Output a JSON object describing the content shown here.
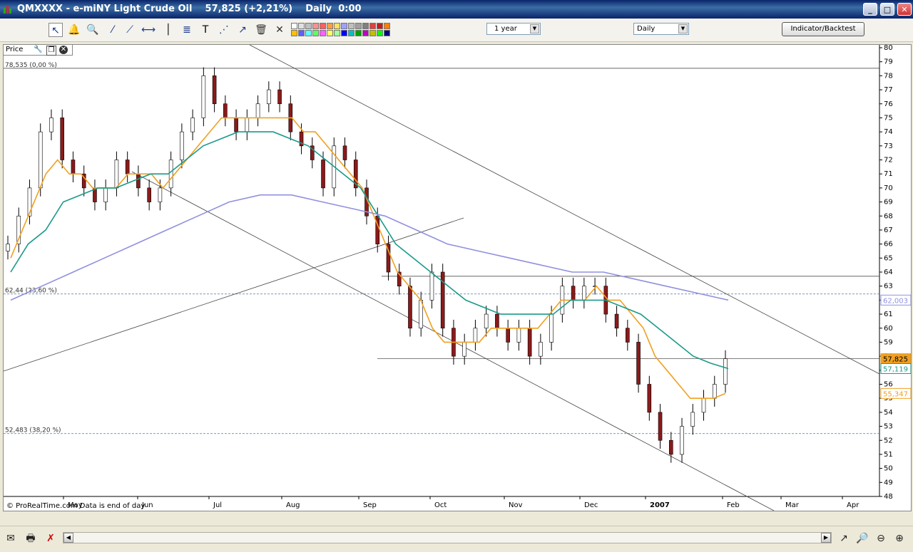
{
  "window": {
    "title": "QMXXXX - e-miNY Light Crude Oil    57,825 (+2,21%)    Daily  0:00",
    "buttons": [
      "_",
      "□",
      "✕"
    ]
  },
  "toolbar": {
    "range_select": "1 year",
    "interval_select": "Daily",
    "indicator_button": "Indicator/Backtest",
    "palette_colors": [
      "#ffffff",
      "#e0e0e0",
      "#c0c0c0",
      "#ff9090",
      "#ff6060",
      "#ffa040",
      "#ffe060",
      "#a0a0ff",
      "#c0c0c0",
      "#a0a0a0",
      "#808080",
      "#e04040",
      "#c02020",
      "#ff8000",
      "#ffc000",
      "#6060ff",
      "#60ffff",
      "#60ff60",
      "#ff60ff",
      "#ffff60",
      "#a0ffa0",
      "#0000ff",
      "#00c0c0",
      "#00a000",
      "#c000c0",
      "#c0c000",
      "#00ff00",
      "#000080"
    ]
  },
  "chart_panel": {
    "label": "Price"
  },
  "chart_data": {
    "type": "line",
    "title": "",
    "instrument": "QMXXXX - e-miNY Light Crude Oil",
    "interval": "Daily",
    "ylim": [
      48,
      80
    ],
    "y_ticks": [
      48,
      49,
      50,
      51,
      52,
      53,
      54,
      55,
      56,
      57,
      58,
      59,
      60,
      61,
      62,
      63,
      64,
      65,
      66,
      67,
      68,
      69,
      70,
      71,
      72,
      73,
      74,
      75,
      76,
      77,
      78,
      79,
      80
    ],
    "x_ticks": [
      "May",
      "Jun",
      "Jul",
      "Aug",
      "Sep",
      "Oct",
      "Nov",
      "Dec",
      "2007",
      "Feb",
      "Mar",
      "Apr"
    ],
    "series": [
      {
        "name": "",
        "style": "candles",
        "color": "#8b1a1a",
        "approx_closes": [
          66,
          68,
          70,
          74,
          75,
          72,
          71,
          70,
          69,
          70,
          72,
          71,
          70,
          69,
          70,
          72,
          74,
          75,
          78,
          76,
          75,
          74,
          75,
          76,
          77,
          76,
          74,
          73,
          72,
          70,
          73,
          72,
          70,
          68,
          66,
          64,
          63,
          60,
          62,
          64,
          60,
          58,
          59,
          60,
          61,
          60,
          59,
          60,
          58,
          59,
          61,
          63,
          62,
          63,
          63,
          61,
          60,
          59,
          56,
          54,
          52,
          51,
          53,
          54,
          55,
          56,
          57.825
        ]
      },
      {
        "name": "",
        "style": "line",
        "color": "#f0a020",
        "approx_values": [
          65,
          67,
          69,
          71,
          72,
          71,
          71,
          70,
          70,
          70,
          71,
          71,
          71,
          70,
          71,
          72,
          73,
          74,
          75,
          75,
          75,
          75,
          75,
          75,
          75,
          74,
          74,
          73,
          72,
          71,
          70,
          68,
          66,
          64,
          63,
          62,
          60,
          59,
          59,
          59,
          59,
          60,
          60,
          60,
          60,
          60,
          61,
          62,
          62,
          62,
          63,
          62,
          62,
          61,
          60,
          58,
          57,
          56,
          55,
          55,
          55,
          55.347
        ]
      },
      {
        "name": "",
        "style": "line",
        "color": "#1a9a8a",
        "approx_values": [
          64,
          66,
          67,
          69,
          69.5,
          70,
          70,
          70.5,
          71,
          71,
          72,
          73,
          73.5,
          74,
          74,
          74,
          73.5,
          73,
          72,
          71,
          70,
          68,
          66,
          65,
          64,
          63,
          62,
          61.5,
          61,
          61,
          61,
          61,
          62,
          62,
          62,
          61.5,
          61,
          60,
          59,
          58,
          57.5,
          57.119
        ]
      },
      {
        "name": "",
        "style": "line",
        "color": "#9090e0",
        "approx_values": [
          62,
          63,
          64,
          65,
          66,
          67,
          68,
          69,
          69.5,
          69.5,
          69,
          68.5,
          68,
          67,
          66,
          65.5,
          65,
          64.5,
          64,
          64,
          63.5,
          63,
          62.5,
          62.003
        ]
      }
    ],
    "horizontal_levels": [
      {
        "value": 78.535,
        "label": "78,535 (0,00 %)",
        "style": "solid"
      },
      {
        "value": 62.44,
        "label": "62,44 (23,60 %)",
        "style": "dashed"
      },
      {
        "value": 52.483,
        "label": "52,483 (38,20 %)",
        "style": "dashed"
      },
      {
        "value": 63.7,
        "label": "",
        "style": "solid"
      },
      {
        "value": 57.825,
        "label": "",
        "style": "solid"
      }
    ],
    "value_tags": [
      {
        "value": 62.003,
        "text": "62,003",
        "color": "#9090e0"
      },
      {
        "value": 57.825,
        "text": "57,825",
        "color": "#f0a020",
        "filled": true
      },
      {
        "value": 57.119,
        "text": "57,119",
        "color": "#1a9a8a"
      },
      {
        "value": 55.347,
        "text": "55,347",
        "color": "#f0a020"
      }
    ],
    "footer": "© ProRealTime.com  Data is end of day"
  }
}
